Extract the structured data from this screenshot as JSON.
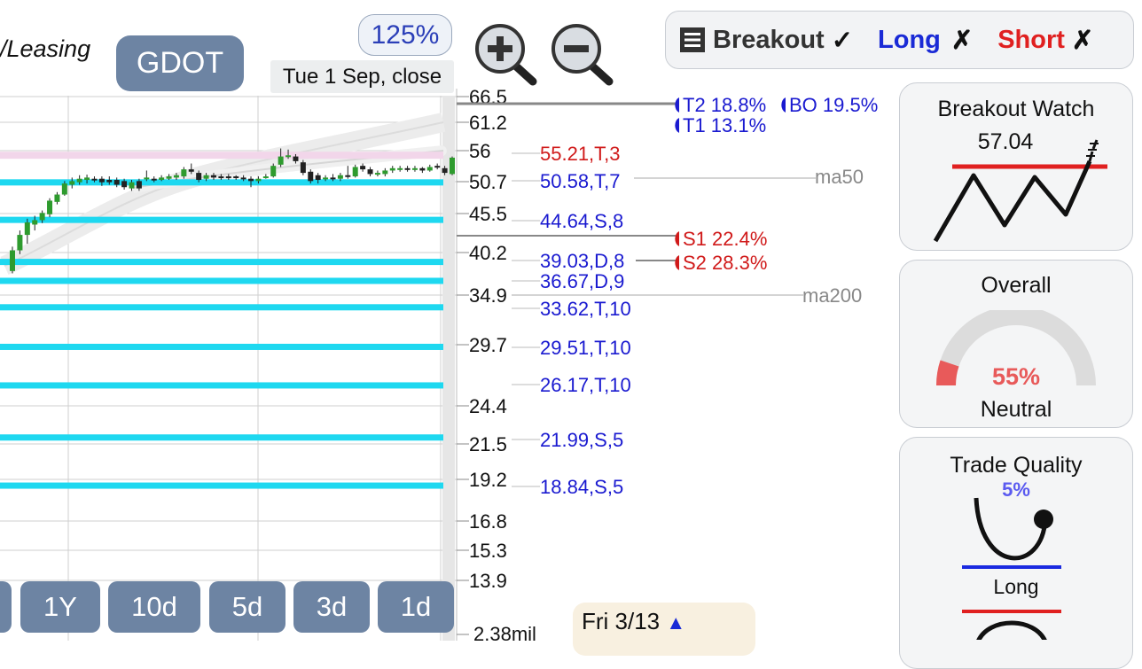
{
  "header": {
    "company_fragment": "/Leasing",
    "ticker": "GDOT",
    "zoom": "125%",
    "date_label": "Tue 1 Sep, close"
  },
  "strategy": {
    "breakout": "Breakout",
    "breakout_mark": "✓",
    "long": "Long",
    "long_mark": "✗",
    "short": "Short",
    "short_mark": "✗"
  },
  "panels": {
    "breakout_watch": {
      "title": "Breakout Watch",
      "value": "57.04"
    },
    "overall": {
      "title": "Overall",
      "percent": "55%",
      "label": "Neutral",
      "gauge_fraction": 0.05
    },
    "trade_quality": {
      "title": "Trade Quality",
      "percent": "5%",
      "label": "Long"
    }
  },
  "range_buttons": [
    "1Y",
    "10d",
    "5d",
    "3d",
    "1d"
  ],
  "news": {
    "label": "Fri 3/13",
    "arrow": "▲"
  },
  "colors": {
    "accent_button": "#6d84a3",
    "level_line": "#1ed8f0",
    "support_text": "#1a1ad0",
    "resist_text": "#d01a1a"
  },
  "chart_data": {
    "type": "candlestick",
    "price_ticks": [
      "66.5",
      "61.2",
      "56",
      "50.7",
      "45.5",
      "40.2",
      "34.9",
      "29.7",
      "24.4",
      "21.5",
      "19.2",
      "16.8",
      "15.3",
      "13.9"
    ],
    "price_tick_values": [
      66.5,
      61.2,
      56,
      50.7,
      45.5,
      40.2,
      34.9,
      29.7,
      24.4,
      21.5,
      19.2,
      16.8,
      15.3,
      13.9
    ],
    "volume_label": "2.38mil",
    "levels": [
      {
        "label": "55.21,T,3",
        "value": 55.21,
        "kind": "resist"
      },
      {
        "label": "50.58,T,7",
        "value": 50.58,
        "kind": "support"
      },
      {
        "label": "44.64,S,8",
        "value": 44.64,
        "kind": "support"
      },
      {
        "label": "39.03,D,8",
        "value": 39.03,
        "kind": "support"
      },
      {
        "label": "36.67,D,9",
        "value": 36.67,
        "kind": "support"
      },
      {
        "label": "33.62,T,10",
        "value": 33.62,
        "kind": "support"
      },
      {
        "label": "29.51,T,10",
        "value": 29.51,
        "kind": "support"
      },
      {
        "label": "26.17,T,10",
        "value": 26.17,
        "kind": "support"
      },
      {
        "label": "21.99,S,5",
        "value": 21.99,
        "kind": "support"
      },
      {
        "label": "18.84,S,5",
        "value": 18.84,
        "kind": "support"
      }
    ],
    "targets": [
      {
        "label": "T2 18.8%",
        "kind": "target"
      },
      {
        "label": "BO 19.5%",
        "kind": "target"
      },
      {
        "label": "T1 13.1%",
        "kind": "target"
      },
      {
        "label": "S1 22.4%",
        "kind": "stop"
      },
      {
        "label": "S2 28.3%",
        "kind": "stop"
      }
    ],
    "moving_averages": [
      "ma50",
      "ma200"
    ],
    "candles": [
      {
        "o": 37.9,
        "c": 40.5,
        "h": 41.0,
        "l": 37.6
      },
      {
        "o": 40.5,
        "c": 42.6,
        "h": 43.2,
        "l": 40.0
      },
      {
        "o": 42.6,
        "c": 44.3,
        "h": 44.8,
        "l": 41.4
      },
      {
        "o": 44.0,
        "c": 44.6,
        "h": 45.2,
        "l": 43.2
      },
      {
        "o": 44.6,
        "c": 45.6,
        "h": 46.0,
        "l": 44.2
      },
      {
        "o": 45.4,
        "c": 47.6,
        "h": 48.0,
        "l": 45.0
      },
      {
        "o": 47.4,
        "c": 48.6,
        "h": 49.0,
        "l": 47.0
      },
      {
        "o": 48.6,
        "c": 50.4,
        "h": 50.8,
        "l": 48.4
      },
      {
        "o": 50.2,
        "c": 50.8,
        "h": 51.4,
        "l": 49.6
      },
      {
        "o": 50.6,
        "c": 51.2,
        "h": 51.8,
        "l": 50.2
      },
      {
        "o": 51.0,
        "c": 51.4,
        "h": 51.9,
        "l": 50.4
      },
      {
        "o": 51.2,
        "c": 51.0,
        "h": 51.6,
        "l": 50.6
      },
      {
        "o": 51.2,
        "c": 50.6,
        "h": 51.6,
        "l": 50.0
      },
      {
        "o": 51.0,
        "c": 50.6,
        "h": 51.6,
        "l": 50.2
      },
      {
        "o": 51.0,
        "c": 50.2,
        "h": 51.4,
        "l": 49.8
      },
      {
        "o": 50.8,
        "c": 49.8,
        "h": 51.2,
        "l": 49.4
      },
      {
        "o": 49.6,
        "c": 50.6,
        "h": 51.0,
        "l": 49.2
      },
      {
        "o": 50.8,
        "c": 49.6,
        "h": 51.2,
        "l": 49.2
      },
      {
        "o": 51.2,
        "c": 51.4,
        "h": 52.6,
        "l": 50.8
      },
      {
        "o": 51.2,
        "c": 51.0,
        "h": 51.6,
        "l": 50.6
      },
      {
        "o": 51.0,
        "c": 51.4,
        "h": 51.8,
        "l": 50.8
      },
      {
        "o": 51.2,
        "c": 51.6,
        "h": 52.0,
        "l": 51.0
      },
      {
        "o": 51.4,
        "c": 51.8,
        "h": 52.2,
        "l": 51.0
      },
      {
        "o": 51.6,
        "c": 52.8,
        "h": 53.2,
        "l": 51.2
      },
      {
        "o": 52.8,
        "c": 52.4,
        "h": 53.8,
        "l": 52.0
      },
      {
        "o": 52.2,
        "c": 51.0,
        "h": 52.6,
        "l": 50.6
      },
      {
        "o": 51.2,
        "c": 51.8,
        "h": 52.2,
        "l": 50.8
      },
      {
        "o": 51.8,
        "c": 51.4,
        "h": 52.2,
        "l": 51.0
      },
      {
        "o": 51.6,
        "c": 51.4,
        "h": 52.0,
        "l": 51.0
      },
      {
        "o": 51.6,
        "c": 51.4,
        "h": 52.0,
        "l": 51.0
      },
      {
        "o": 51.6,
        "c": 51.4,
        "h": 51.8,
        "l": 51.0
      },
      {
        "o": 51.4,
        "c": 51.2,
        "h": 51.8,
        "l": 50.8
      },
      {
        "o": 51.2,
        "c": 50.8,
        "h": 51.6,
        "l": 49.8
      },
      {
        "o": 50.8,
        "c": 51.2,
        "h": 51.6,
        "l": 50.4
      },
      {
        "o": 51.4,
        "c": 51.6,
        "h": 52.0,
        "l": 51.2
      },
      {
        "o": 51.6,
        "c": 53.4,
        "h": 53.8,
        "l": 51.4
      },
      {
        "o": 53.6,
        "c": 55.0,
        "h": 56.4,
        "l": 53.2
      },
      {
        "o": 55.0,
        "c": 55.2,
        "h": 56.2,
        "l": 54.6
      },
      {
        "o": 55.0,
        "c": 54.2,
        "h": 55.4,
        "l": 53.8
      },
      {
        "o": 54.0,
        "c": 52.2,
        "h": 54.4,
        "l": 51.8
      },
      {
        "o": 52.4,
        "c": 50.8,
        "h": 52.8,
        "l": 50.4
      },
      {
        "o": 51.8,
        "c": 51.0,
        "h": 52.2,
        "l": 50.4
      },
      {
        "o": 51.2,
        "c": 51.4,
        "h": 51.8,
        "l": 50.8
      },
      {
        "o": 51.4,
        "c": 51.2,
        "h": 52.0,
        "l": 50.8
      },
      {
        "o": 51.2,
        "c": 51.8,
        "h": 52.2,
        "l": 50.8
      },
      {
        "o": 51.8,
        "c": 51.6,
        "h": 53.4,
        "l": 51.2
      },
      {
        "o": 51.6,
        "c": 53.2,
        "h": 53.6,
        "l": 51.4
      },
      {
        "o": 53.4,
        "c": 52.8,
        "h": 53.8,
        "l": 52.4
      },
      {
        "o": 52.8,
        "c": 52.0,
        "h": 53.2,
        "l": 51.6
      },
      {
        "o": 52.0,
        "c": 52.2,
        "h": 52.6,
        "l": 51.6
      },
      {
        "o": 52.0,
        "c": 52.6,
        "h": 53.0,
        "l": 51.6
      },
      {
        "o": 52.6,
        "c": 53.0,
        "h": 53.4,
        "l": 52.2
      },
      {
        "o": 52.8,
        "c": 53.0,
        "h": 53.4,
        "l": 52.4
      },
      {
        "o": 53.0,
        "c": 52.8,
        "h": 53.4,
        "l": 52.4
      },
      {
        "o": 52.8,
        "c": 53.0,
        "h": 53.4,
        "l": 52.4
      },
      {
        "o": 53.0,
        "c": 52.6,
        "h": 53.2,
        "l": 52.2
      },
      {
        "o": 52.6,
        "c": 53.2,
        "h": 53.6,
        "l": 52.4
      },
      {
        "o": 53.4,
        "c": 53.2,
        "h": 53.8,
        "l": 52.8
      },
      {
        "o": 53.0,
        "c": 52.2,
        "h": 53.4,
        "l": 51.8
      },
      {
        "o": 52.0,
        "c": 54.8,
        "h": 55.0,
        "l": 51.8
      }
    ]
  }
}
